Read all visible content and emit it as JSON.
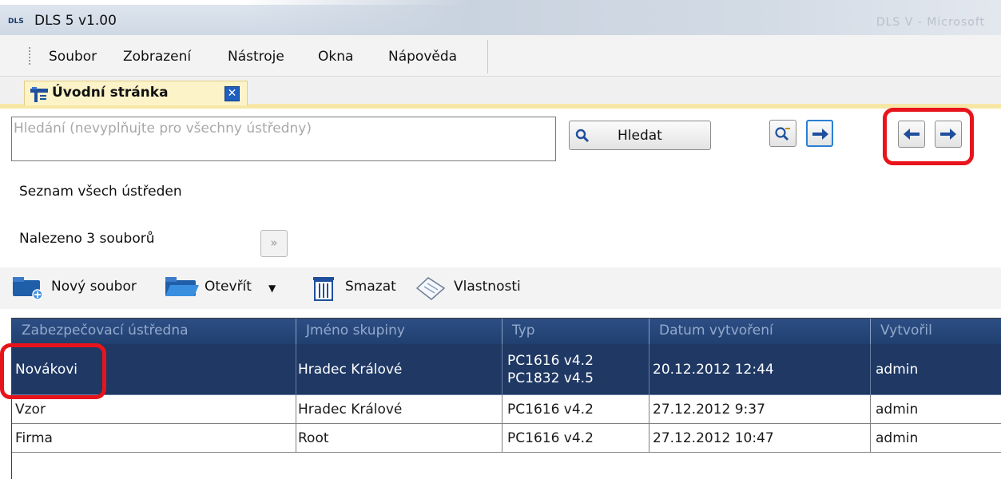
{
  "window": {
    "app_logo": "DLS",
    "title": "DLS 5 v1.00",
    "taskbar_hint": "DLS V - Microsoft"
  },
  "menu": {
    "items": [
      "Soubor",
      "Zobrazení",
      "Nástroje",
      "Okna",
      "Nápověda"
    ]
  },
  "tab": {
    "label": "Úvodní stránka",
    "close": "✕"
  },
  "search": {
    "placeholder": "Hledání (nevyplňujte pro všechny ústředny)",
    "value": "",
    "button_label": "Hledat"
  },
  "info": {
    "list_title": "Seznam všech ústředen",
    "found": "Nalezeno 3 souborů"
  },
  "toolbar": {
    "new_file": "Nový soubor",
    "open": "Otevřít",
    "delete": "Smazat",
    "properties": "Vlastnosti"
  },
  "grid": {
    "columns": [
      "Zabezpečovací ústředna",
      "Jméno skupiny",
      "Typ",
      "Datum vytvoření",
      "Vytvořil"
    ],
    "rows": [
      {
        "panel": "Novákovi",
        "group": "Hradec Králové",
        "type_1": "PC1616 v4.2",
        "type_2": "PC1832 v4.5",
        "created": "20.12.2012 12:44",
        "author": "admin",
        "selected": true
      },
      {
        "panel": "Vzor",
        "group": "Hradec Králové",
        "type_1": "PC1616 v4.2",
        "created": "27.12.2012 9:37",
        "author": "admin"
      },
      {
        "panel": "Firma",
        "group": "Root",
        "type_1": "PC1616 v4.2",
        "created": "27.12.2012 10:47",
        "author": "admin"
      }
    ]
  },
  "colors": {
    "highlight": "#e8141c",
    "selection": "#1f3864",
    "header": "#2d4e85"
  }
}
